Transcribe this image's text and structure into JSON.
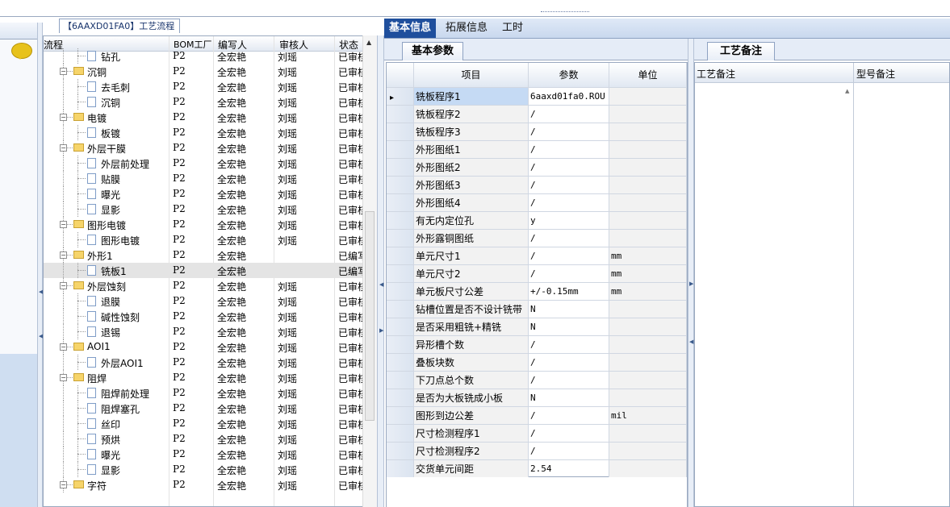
{
  "tree": {
    "tab_title": "【6AAXD01FA0】工艺流程",
    "columns": [
      "流程",
      "BOM工厂",
      "编写人",
      "审核人",
      "状态"
    ],
    "rows": [
      {
        "name": "钻孔",
        "level": 1,
        "kind": "doc",
        "bom": "P2",
        "writer": "全宏艳",
        "reviewer": "刘瑶",
        "status": "已审核"
      },
      {
        "name": "沉铜",
        "level": 0,
        "kind": "folder",
        "bom": "P2",
        "writer": "全宏艳",
        "reviewer": "刘瑶",
        "status": "已审核"
      },
      {
        "name": "去毛刺",
        "level": 1,
        "kind": "doc",
        "bom": "P2",
        "writer": "全宏艳",
        "reviewer": "刘瑶",
        "status": "已审核"
      },
      {
        "name": "沉铜",
        "level": 1,
        "kind": "doc",
        "bom": "P2",
        "writer": "全宏艳",
        "reviewer": "刘瑶",
        "status": "已审核"
      },
      {
        "name": "电镀",
        "level": 0,
        "kind": "folder",
        "bom": "P2",
        "writer": "全宏艳",
        "reviewer": "刘瑶",
        "status": "已审核"
      },
      {
        "name": "板镀",
        "level": 1,
        "kind": "doc",
        "bom": "P2",
        "writer": "全宏艳",
        "reviewer": "刘瑶",
        "status": "已审核"
      },
      {
        "name": "外层干膜",
        "level": 0,
        "kind": "folder",
        "bom": "P2",
        "writer": "全宏艳",
        "reviewer": "刘瑶",
        "status": "已审核"
      },
      {
        "name": "外层前处理",
        "level": 1,
        "kind": "doc",
        "bom": "P2",
        "writer": "全宏艳",
        "reviewer": "刘瑶",
        "status": "已审核"
      },
      {
        "name": "贴膜",
        "level": 1,
        "kind": "doc",
        "bom": "P2",
        "writer": "全宏艳",
        "reviewer": "刘瑶",
        "status": "已审核"
      },
      {
        "name": "曝光",
        "level": 1,
        "kind": "doc",
        "bom": "P2",
        "writer": "全宏艳",
        "reviewer": "刘瑶",
        "status": "已审核"
      },
      {
        "name": "显影",
        "level": 1,
        "kind": "doc",
        "bom": "P2",
        "writer": "全宏艳",
        "reviewer": "刘瑶",
        "status": "已审核"
      },
      {
        "name": "图形电镀",
        "level": 0,
        "kind": "folder",
        "bom": "P2",
        "writer": "全宏艳",
        "reviewer": "刘瑶",
        "status": "已审核"
      },
      {
        "name": "图形电镀",
        "level": 1,
        "kind": "doc",
        "bom": "P2",
        "writer": "全宏艳",
        "reviewer": "刘瑶",
        "status": "已审核"
      },
      {
        "name": "外形1",
        "level": 0,
        "kind": "folder",
        "bom": "P2",
        "writer": "全宏艳",
        "reviewer": "",
        "status": "已编写"
      },
      {
        "name": "铣板1",
        "level": 1,
        "kind": "doc",
        "bom": "P2",
        "writer": "全宏艳",
        "reviewer": "",
        "status": "已编写",
        "selected": true
      },
      {
        "name": "外层蚀刻",
        "level": 0,
        "kind": "folder",
        "bom": "P2",
        "writer": "全宏艳",
        "reviewer": "刘瑶",
        "status": "已审核"
      },
      {
        "name": "退膜",
        "level": 1,
        "kind": "doc",
        "bom": "P2",
        "writer": "全宏艳",
        "reviewer": "刘瑶",
        "status": "已审核"
      },
      {
        "name": "碱性蚀刻",
        "level": 1,
        "kind": "doc",
        "bom": "P2",
        "writer": "全宏艳",
        "reviewer": "刘瑶",
        "status": "已审核"
      },
      {
        "name": "退锡",
        "level": 1,
        "kind": "doc",
        "bom": "P2",
        "writer": "全宏艳",
        "reviewer": "刘瑶",
        "status": "已审核"
      },
      {
        "name": "AOI1",
        "level": 0,
        "kind": "folder",
        "bom": "P2",
        "writer": "全宏艳",
        "reviewer": "刘瑶",
        "status": "已审核"
      },
      {
        "name": "外层AOI1",
        "level": 1,
        "kind": "doc",
        "bom": "P2",
        "writer": "全宏艳",
        "reviewer": "刘瑶",
        "status": "已审核"
      },
      {
        "name": "阻焊",
        "level": 0,
        "kind": "folder",
        "bom": "P2",
        "writer": "全宏艳",
        "reviewer": "刘瑶",
        "status": "已审核"
      },
      {
        "name": "阻焊前处理",
        "level": 1,
        "kind": "doc",
        "bom": "P2",
        "writer": "全宏艳",
        "reviewer": "刘瑶",
        "status": "已审核"
      },
      {
        "name": "阻焊塞孔",
        "level": 1,
        "kind": "doc",
        "bom": "P2",
        "writer": "全宏艳",
        "reviewer": "刘瑶",
        "status": "已审核"
      },
      {
        "name": "丝印",
        "level": 1,
        "kind": "doc",
        "bom": "P2",
        "writer": "全宏艳",
        "reviewer": "刘瑶",
        "status": "已审核"
      },
      {
        "name": "预烘",
        "level": 1,
        "kind": "doc",
        "bom": "P2",
        "writer": "全宏艳",
        "reviewer": "刘瑶",
        "status": "已审核"
      },
      {
        "name": "曝光",
        "level": 1,
        "kind": "doc",
        "bom": "P2",
        "writer": "全宏艳",
        "reviewer": "刘瑶",
        "status": "已审核"
      },
      {
        "name": "显影",
        "level": 1,
        "kind": "doc",
        "bom": "P2",
        "writer": "全宏艳",
        "reviewer": "刘瑶",
        "status": "已审核"
      },
      {
        "name": "字符",
        "level": 0,
        "kind": "folder",
        "bom": "P2",
        "writer": "全宏艳",
        "reviewer": "刘瑶",
        "status": "已审核"
      }
    ]
  },
  "tabs": [
    "基本信息",
    "拓展信息",
    "工时"
  ],
  "basic": {
    "subtab": "基本参数",
    "columns": [
      "项目",
      "参数",
      "单位"
    ],
    "rows": [
      {
        "item": "铣板程序1",
        "param": "6aaxd01fa0.ROU",
        "unit": ""
      },
      {
        "item": "铣板程序2",
        "param": "/",
        "unit": ""
      },
      {
        "item": "铣板程序3",
        "param": "/",
        "unit": ""
      },
      {
        "item": "外形图纸1",
        "param": "/",
        "unit": ""
      },
      {
        "item": "外形图纸2",
        "param": "/",
        "unit": ""
      },
      {
        "item": "外形图纸3",
        "param": "/",
        "unit": ""
      },
      {
        "item": "外形图纸4",
        "param": "/",
        "unit": ""
      },
      {
        "item": "有无内定位孔",
        "param": "y",
        "unit": ""
      },
      {
        "item": "外形露铜图纸",
        "param": "/",
        "unit": ""
      },
      {
        "item": "单元尺寸1",
        "param": "/",
        "unit": "mm"
      },
      {
        "item": "单元尺寸2",
        "param": "/",
        "unit": "mm"
      },
      {
        "item": "单元板尺寸公差",
        "param": "+/-0.15mm",
        "unit": "mm"
      },
      {
        "item": "钻槽位置是否不设计铣带",
        "param": "N",
        "unit": ""
      },
      {
        "item": "是否采用粗铣+精铣",
        "param": "N",
        "unit": ""
      },
      {
        "item": "异形槽个数",
        "param": "/",
        "unit": ""
      },
      {
        "item": "叠板块数",
        "param": "/",
        "unit": ""
      },
      {
        "item": "下刀点总个数",
        "param": "/",
        "unit": ""
      },
      {
        "item": "是否为大板铣成小板",
        "param": "N",
        "unit": ""
      },
      {
        "item": "图形到边公差",
        "param": "/",
        "unit": "mil"
      },
      {
        "item": "尺寸检测程序1",
        "param": "/",
        "unit": ""
      },
      {
        "item": "尺寸检测程序2",
        "param": "/",
        "unit": ""
      },
      {
        "item": "交货单元间距",
        "param": "2.54",
        "unit": ""
      }
    ]
  },
  "notes": {
    "subtab": "工艺备注",
    "columns": [
      "工艺备注",
      "型号备注"
    ]
  }
}
